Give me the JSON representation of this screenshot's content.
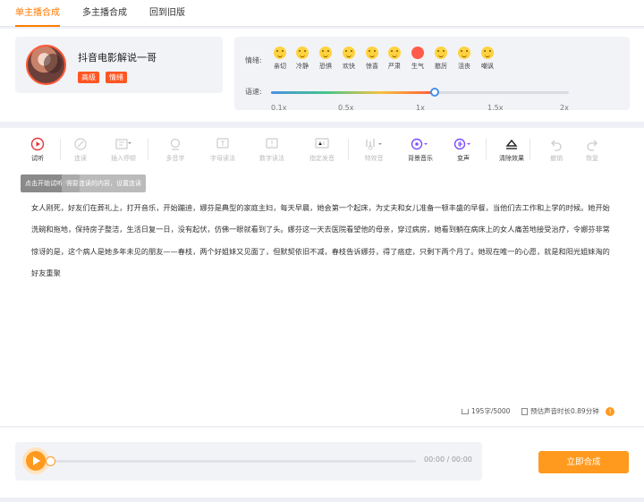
{
  "tabs": [
    {
      "label": "单主播合成",
      "active": true
    },
    {
      "label": "多主播合成",
      "active": false
    },
    {
      "label": "回到旧版",
      "active": false
    }
  ],
  "anchor": {
    "name": "抖音电影解说一哥",
    "tags": [
      "高级",
      "情绪"
    ]
  },
  "emotion": {
    "label": "情绪:",
    "options": [
      {
        "name": "亲切",
        "icon": "smile-face-icon"
      },
      {
        "name": "冷静",
        "icon": "calm-face-icon"
      },
      {
        "name": "恐惧",
        "icon": "fear-face-icon"
      },
      {
        "name": "欢快",
        "icon": "laugh-face-icon"
      },
      {
        "name": "惊喜",
        "icon": "surprise-face-icon"
      },
      {
        "name": "严肃",
        "icon": "serious-face-icon"
      },
      {
        "name": "生气",
        "icon": "angry-face-icon"
      },
      {
        "name": "憨厉",
        "icon": "stern-face-icon"
      },
      {
        "name": "沮丧",
        "icon": "sad-face-icon"
      },
      {
        "name": "嘲讽",
        "icon": "mock-face-icon"
      }
    ]
  },
  "speed": {
    "label": "语速:",
    "value": "1x",
    "value_fraction": 0.55,
    "ticks": [
      "0.1x",
      "0.5x",
      "1x",
      "1.5x",
      "2x"
    ]
  },
  "toolbar": {
    "items": [
      {
        "label": "试听",
        "icon": "play-circle-icon",
        "enabled": true
      },
      {
        "label": "连读",
        "icon": "link-icon",
        "enabled": false
      },
      {
        "label": "插入停顿",
        "icon": "pause-insert-icon",
        "enabled": false
      },
      {
        "label": "多音字",
        "icon": "search-char-icon",
        "enabled": false
      },
      {
        "label": "字母读法",
        "icon": "letter-icon",
        "enabled": false
      },
      {
        "label": "数字读法",
        "icon": "number-icon",
        "enabled": false
      },
      {
        "label": "指定发音",
        "icon": "pronounce-icon",
        "enabled": false
      },
      {
        "label": "特效音",
        "icon": "sound-effect-icon",
        "enabled": false
      },
      {
        "label": "背景音乐",
        "icon": "music-icon",
        "enabled": true
      },
      {
        "label": "变声",
        "icon": "voice-change-icon",
        "enabled": true
      },
      {
        "label": "清除效果",
        "icon": "eraser-icon",
        "enabled": true
      },
      {
        "label": "撤销",
        "icon": "undo-icon",
        "enabled": false
      },
      {
        "label": "恢复",
        "icon": "redo-icon",
        "enabled": false
      }
    ],
    "tooltips": [
      "点击开始试听内容",
      "需要连读的内容，设置连读"
    ]
  },
  "content": {
    "text": "女人刚死，好友们在葬礼上，打开音乐，开始蹦迪，娜芬是典型的家庭主妇，每天早晨，她会第一个起床，为丈夫和女儿准备一顿丰盛的早餐，当他们去工作和上学的时候。她开始洗碗和拖地，保持房子整洁，生活日复一日，没有起伏，仿佛一眼就看到了头。娜芬这一天去医院看望他的母亲，穿过病房，她看到躺在病床上的女人痛苦地接受治疗，令娜芬非常惊讶的是，这个病人是她多年未见的朋友——春枝，两个好姐妹又见面了，但默契依旧不减，春枝告诉娜芬，得了癌症，只剩下两个月了。她现在唯一的心愿，就是和阳光姐妹淘的好友重聚"
  },
  "stats": {
    "char_count": "195字/5000",
    "estimate": "预估声音时长0.89分钟"
  },
  "player": {
    "time": "00:00 / 00:00",
    "progress": 0
  },
  "actions": {
    "synthesize": "立即合成"
  },
  "colors": {
    "accent": "#ff9a1f",
    "tab_active": "#ff7a00",
    "tag": "#ff5522",
    "speed_start": "#4a90e2",
    "speed_end": "#ff5a36"
  }
}
